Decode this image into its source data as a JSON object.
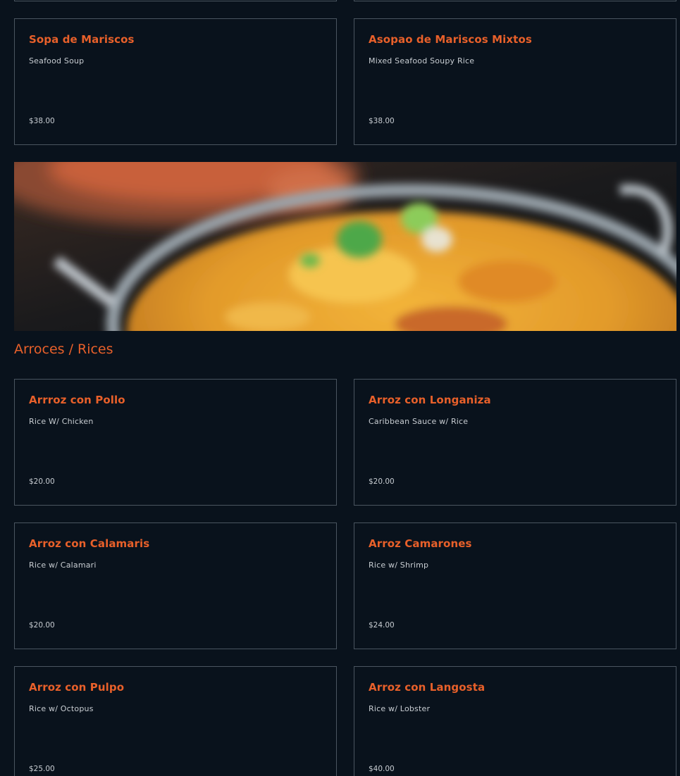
{
  "colors": {
    "background": "#09121c",
    "accent": "#e8602a",
    "text": "#c8cdd2",
    "card_border": "#4a5560"
  },
  "top_items": [
    {
      "name": "Sopa de Mariscos",
      "description": "Seafood Soup",
      "price": "$38.00"
    },
    {
      "name": "Asopao de Mariscos Mixtos",
      "description": "Mixed Seafood Soupy Rice",
      "price": "$38.00"
    }
  ],
  "section": {
    "title": "Arroces / Rices"
  },
  "rice_items": [
    {
      "name": "Arrroz con Pollo",
      "description": "Rice W/ Chicken",
      "price": "$20.00"
    },
    {
      "name": "Arroz con Longaniza",
      "description": "Caribbean Sauce w/ Rice",
      "price": "$20.00"
    },
    {
      "name": "Arroz con Calamaris",
      "description": "Rice w/ Calamari",
      "price": "$20.00"
    },
    {
      "name": "Arroz Camarones",
      "description": "Rice w/ Shrimp",
      "price": "$24.00"
    },
    {
      "name": "Arroz con Pulpo",
      "description": "Rice w/ Octopus",
      "price": "$25.00"
    },
    {
      "name": "Arroz con Langosta",
      "description": "Rice w/ Lobster",
      "price": "$40.00"
    }
  ]
}
